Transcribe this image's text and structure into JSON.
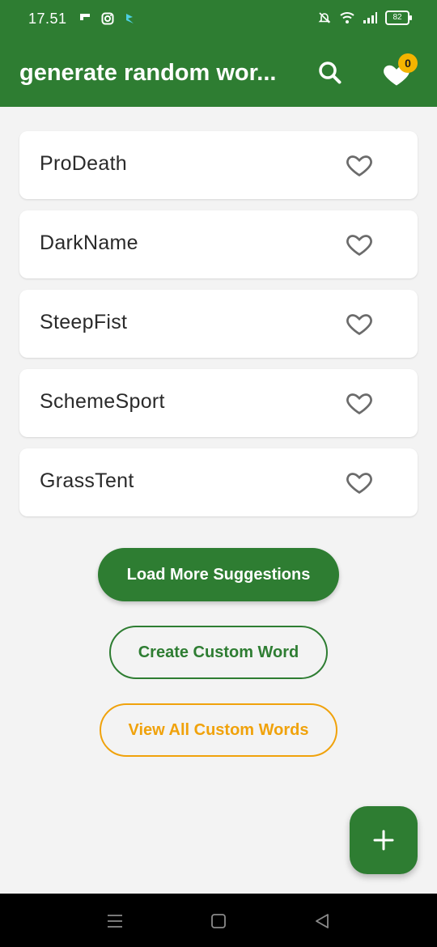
{
  "status_bar": {
    "time": "17.51",
    "battery": "82",
    "left_icons": [
      "flipboard-icon",
      "instagram-icon",
      "bird-icon"
    ],
    "right_icons": [
      "mute-icon",
      "wifi-icon",
      "signal-icon",
      "battery-icon"
    ]
  },
  "app_bar": {
    "title": "generate random wor...",
    "favorites_count": "0",
    "actions": [
      "search-icon",
      "heart-icon"
    ]
  },
  "words": [
    {
      "text": "ProDeath",
      "favorited": false
    },
    {
      "text": "DarkName",
      "favorited": false
    },
    {
      "text": "SteepFist",
      "favorited": false
    },
    {
      "text": "SchemeSport",
      "favorited": false
    },
    {
      "text": "GrassTent",
      "favorited": false
    }
  ],
  "buttons": {
    "load_more": "Load More Suggestions",
    "create_custom": "Create Custom Word",
    "view_all": "View All Custom Words"
  },
  "fab": {
    "icon": "plus-icon"
  },
  "navigation": [
    "menu-icon",
    "home-icon",
    "back-icon"
  ],
  "colors": {
    "primary": "#2e7d32",
    "accent": "#f0a20b",
    "badge": "#f4b400",
    "background": "#f3f3f3"
  }
}
